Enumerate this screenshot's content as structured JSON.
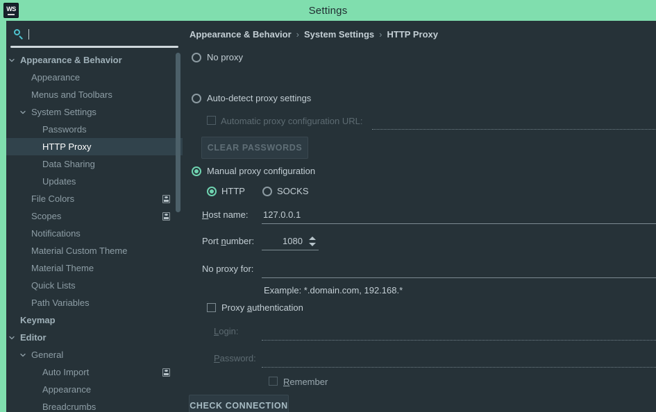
{
  "window": {
    "title": "Settings",
    "logo_text": "WS"
  },
  "sidebar": {
    "search": {
      "value": "",
      "placeholder": "",
      "icon": "search-icon"
    },
    "items": [
      {
        "label": "Appearance & Behavior",
        "indent": 0,
        "chevron": "down",
        "bold": true,
        "selected": false,
        "badge": false
      },
      {
        "label": "Appearance",
        "indent": 1,
        "chevron": "none",
        "bold": false,
        "selected": false,
        "badge": false
      },
      {
        "label": "Menus and Toolbars",
        "indent": 1,
        "chevron": "none",
        "bold": false,
        "selected": false,
        "badge": false
      },
      {
        "label": "System Settings",
        "indent": 1,
        "chevron": "down",
        "bold": false,
        "selected": false,
        "badge": false
      },
      {
        "label": "Passwords",
        "indent": 2,
        "chevron": "none",
        "bold": false,
        "selected": false,
        "badge": false
      },
      {
        "label": "HTTP Proxy",
        "indent": 2,
        "chevron": "none",
        "bold": false,
        "selected": true,
        "badge": false
      },
      {
        "label": "Data Sharing",
        "indent": 2,
        "chevron": "none",
        "bold": false,
        "selected": false,
        "badge": false
      },
      {
        "label": "Updates",
        "indent": 2,
        "chevron": "none",
        "bold": false,
        "selected": false,
        "badge": false
      },
      {
        "label": "File Colors",
        "indent": 1,
        "chevron": "none",
        "bold": false,
        "selected": false,
        "badge": true
      },
      {
        "label": "Scopes",
        "indent": 1,
        "chevron": "none",
        "bold": false,
        "selected": false,
        "badge": true
      },
      {
        "label": "Notifications",
        "indent": 1,
        "chevron": "none",
        "bold": false,
        "selected": false,
        "badge": false
      },
      {
        "label": "Material Custom Theme",
        "indent": 1,
        "chevron": "none",
        "bold": false,
        "selected": false,
        "badge": false
      },
      {
        "label": "Material Theme",
        "indent": 1,
        "chevron": "none",
        "bold": false,
        "selected": false,
        "badge": false
      },
      {
        "label": "Quick Lists",
        "indent": 1,
        "chevron": "none",
        "bold": false,
        "selected": false,
        "badge": false
      },
      {
        "label": "Path Variables",
        "indent": 1,
        "chevron": "none",
        "bold": false,
        "selected": false,
        "badge": false
      },
      {
        "label": "Keymap",
        "indent": 0,
        "chevron": "none",
        "bold": true,
        "selected": false,
        "badge": false
      },
      {
        "label": "Editor",
        "indent": 0,
        "chevron": "down",
        "bold": true,
        "selected": false,
        "badge": false
      },
      {
        "label": "General",
        "indent": 1,
        "chevron": "down",
        "bold": false,
        "selected": false,
        "badge": false
      },
      {
        "label": "Auto Import",
        "indent": 2,
        "chevron": "none",
        "bold": false,
        "selected": false,
        "badge": true
      },
      {
        "label": "Appearance",
        "indent": 2,
        "chevron": "none",
        "bold": false,
        "selected": false,
        "badge": false
      },
      {
        "label": "Breadcrumbs",
        "indent": 2,
        "chevron": "none",
        "bold": false,
        "selected": false,
        "badge": false
      }
    ]
  },
  "main": {
    "breadcrumb": {
      "part1": "Appearance & Behavior",
      "sep1": "›",
      "part2": "System Settings",
      "sep2": "›",
      "part3": "HTTP Proxy"
    },
    "proxy_mode": {
      "no_proxy_label": "No proxy",
      "no_proxy_selected": false,
      "auto_detect_label": "Auto-detect proxy settings",
      "auto_detect_selected": false,
      "manual_label": "Manual proxy configuration",
      "manual_selected": true
    },
    "auto_config": {
      "checkbox_label": "Automatic proxy configuration URL:",
      "checkbox_checked": false,
      "url_value": "",
      "clear_passwords_label": "CLEAR PASSWORDS"
    },
    "protocol": {
      "http_label": "HTTP",
      "http_selected": true,
      "socks_label": "SOCKS",
      "socks_selected": false
    },
    "host": {
      "label": "Host name:",
      "mnemonic": "H",
      "value": "127.0.0.1"
    },
    "port": {
      "label": "Port number:",
      "mnemonic": "n",
      "value": "1080"
    },
    "no_proxy_for": {
      "label": "No proxy for:",
      "value": "",
      "example": "Example: *.domain.com, 192.168.*"
    },
    "auth": {
      "checkbox_label": "Proxy authentication",
      "mnemonic": "a",
      "checked": false,
      "login_label": "Login:",
      "login_mnemonic": "L",
      "login_value": "",
      "password_label": "Password:",
      "password_mnemonic": "P",
      "password_value": "",
      "remember_label": "Remember",
      "remember_mnemonic": "R",
      "remember_checked": false
    },
    "check_connection_label": "CHECK CONNECTION"
  },
  "colors": {
    "accent": "#80deae",
    "panel_bg": "#263238",
    "selection": "#31434c",
    "radio_on": "#6fd3b0",
    "search_icon": "#4fc3cf"
  }
}
